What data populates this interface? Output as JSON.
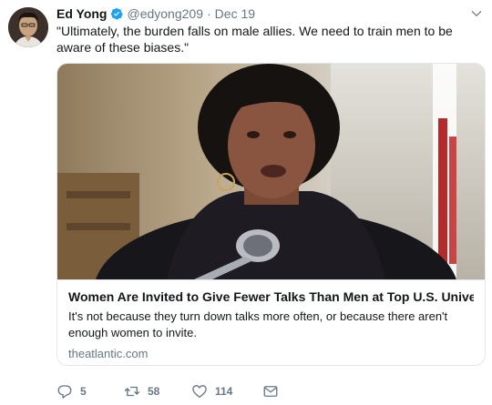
{
  "tweet": {
    "author_name": "Ed Yong",
    "handle": "@edyong209",
    "separator": "·",
    "date": "Dec 19",
    "text": "\"Ultimately, the burden falls on male allies. We need to train men to be aware of these biases.\""
  },
  "card": {
    "title": "Women Are Invited to Give Fewer Talks Than Men at Top U.S. Univers...",
    "description": "It's not because they turn down talks more often, or because there aren't enough women to invite.",
    "domain": "theatlantic.com"
  },
  "actions": {
    "replies": "5",
    "retweets": "58",
    "likes": "114"
  },
  "icons": {
    "verified": "verified-badge-icon",
    "menu": "chevron-down-icon",
    "reply": "reply-icon",
    "retweet": "retweet-icon",
    "like": "heart-icon",
    "dm": "envelope-icon"
  },
  "colors": {
    "accent": "#1da1f2",
    "secondary_text": "#657786",
    "border": "#e1e8ed"
  }
}
